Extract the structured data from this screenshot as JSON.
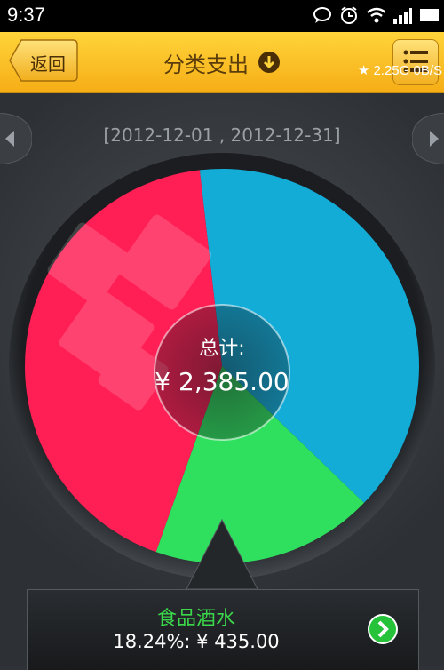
{
  "status": {
    "time": "9:37"
  },
  "header": {
    "back_label": "返回",
    "title": "分类支出",
    "speed": "★ 2.25G 0B/S"
  },
  "main": {
    "date_range": "[2012-12-01 , 2012-12-31]",
    "total_label": "总计:",
    "total_value": "¥ 2,385.00"
  },
  "selected": {
    "name": "食品酒水",
    "detail": "18.24%: ¥ 435.00"
  },
  "chart_data": {
    "type": "pie",
    "slices": [
      {
        "color": "#12acd7",
        "value": 39.0
      },
      {
        "color": "#2fe05e",
        "value": 18.24
      },
      {
        "color": "#ff1f55",
        "value": 42.76
      }
    ]
  },
  "colors": {
    "header": "#f6ad16",
    "accent_green": "#3ad84a"
  }
}
